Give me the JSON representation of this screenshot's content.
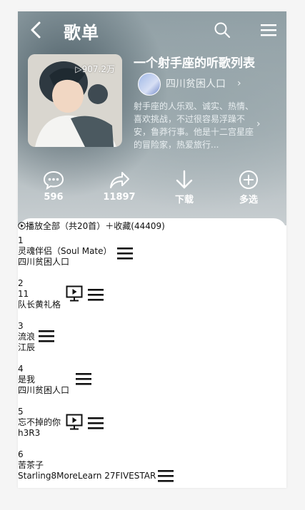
{
  "nav": {
    "title": "歌单"
  },
  "playlist": {
    "play_count": "907.2万",
    "name": "一个射手座的听歌列表",
    "creator": "四川贫困人口",
    "description": "射手座的人乐观、诚实、热情、喜欢挑战，不过很容易浮躁不安，鲁莽行事。他是十二宫星座的冒险家，热爱旅行..."
  },
  "actions": {
    "comments": "596",
    "shares": "11897",
    "download": "下载",
    "multi_select": "多选"
  },
  "list": {
    "play_all": "播放全部（共20首）",
    "collect": "＋收藏(44409)"
  },
  "songs": [
    {
      "index": "1",
      "title": "灵魂伴侣（Soul Mate）",
      "artist": "四川贫困人口",
      "mv": false
    },
    {
      "index": "2",
      "title": "11",
      "artist": "队长黄礼格",
      "mv": true
    },
    {
      "index": "3",
      "title": "流浪",
      "artist": "江辰",
      "mv": false
    },
    {
      "index": "4",
      "title": "是我",
      "artist": "四川贫困人口",
      "mv": false
    },
    {
      "index": "5",
      "title": "忘不掉的你",
      "artist": "h3R3",
      "mv": true
    },
    {
      "index": "6",
      "title": "苦茶子",
      "artist": "Starling8MoreLearn 27FIVESTAR",
      "mv": false
    }
  ]
}
